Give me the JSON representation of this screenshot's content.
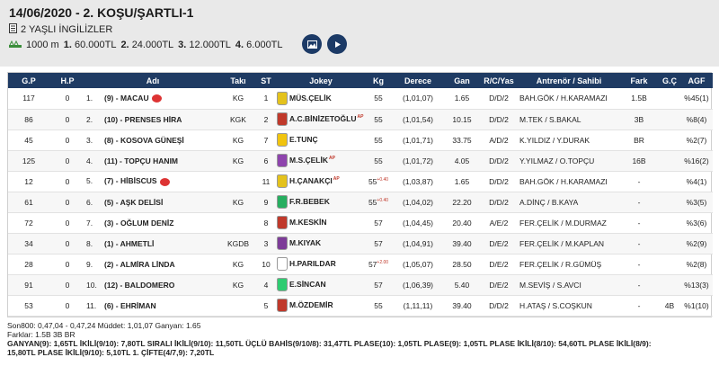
{
  "header": {
    "title": "14/06/2020 - 2. KOŞU/ŞARTLI-1",
    "subtitle": "2 YAŞLI İNGİLİZLER",
    "distance": "1000 m",
    "prizes": [
      {
        "rank": "1.",
        "amount": "60.000TL"
      },
      {
        "rank": "2.",
        "amount": "24.000TL"
      },
      {
        "rank": "3.",
        "amount": "12.000TL"
      },
      {
        "rank": "4.",
        "amount": "6.000TL"
      }
    ],
    "icons": {
      "camera": "camera-icon",
      "video": "play-icon"
    }
  },
  "columns": [
    "G.P",
    "H.P",
    "Adı",
    "Takı",
    "ST",
    "Jokey",
    "Kg",
    "Derece",
    "Gan",
    "R/C/Yas",
    "Antrenör / Sahibi",
    "Fark",
    "G.Ç",
    "AGF"
  ],
  "rows": [
    {
      "gp": "117",
      "hp": "0",
      "rank": "1.",
      "name": "(9) - MACAU",
      "taki": "KG",
      "st": "1",
      "jokey": "MÜS.ÇELİK",
      "jsup": "",
      "kg": "55",
      "kgsup": "",
      "derece": "(1,01,07)",
      "gan": "1.65",
      "rcy": "D/D/2",
      "trainer": "BAH.GÖK / H.KARAMAZI",
      "fark": "1.5B",
      "gc": "",
      "agf": "%45(1)",
      "badge": true,
      "jersey": "#e4c21c"
    },
    {
      "gp": "86",
      "hp": "0",
      "rank": "2.",
      "name": "(10) - PRENSES HİRA",
      "taki": "KGK",
      "st": "2",
      "jokey": "A.C.BİNİZETOĞLU",
      "jsup": "AP",
      "kg": "55",
      "kgsup": "",
      "derece": "(1,01,54)",
      "gan": "10.15",
      "rcy": "D/D/2",
      "trainer": "M.TEK / S.BAKAL",
      "fark": "3B",
      "gc": "",
      "agf": "%8(4)",
      "badge": false,
      "jersey": "#c0392b"
    },
    {
      "gp": "45",
      "hp": "0",
      "rank": "3.",
      "name": "(8) - KOSOVA GÜNEŞİ",
      "taki": "KG",
      "st": "7",
      "jokey": "E.TUNÇ",
      "jsup": "",
      "kg": "55",
      "kgsup": "",
      "derece": "(1,01,71)",
      "gan": "33.75",
      "rcy": "A/D/2",
      "trainer": "K.YILDIZ / Y.DURAK",
      "fark": "BR",
      "gc": "",
      "agf": "%2(7)",
      "badge": false,
      "jersey": "#f1c40f"
    },
    {
      "gp": "125",
      "hp": "0",
      "rank": "4.",
      "name": "(11) - TOPÇU HANIM",
      "taki": "KG",
      "st": "6",
      "jokey": "M.S.ÇELİK",
      "jsup": "AP",
      "kg": "55",
      "kgsup": "",
      "derece": "(1,01,72)",
      "gan": "4.05",
      "rcy": "D/D/2",
      "trainer": "Y.YILMAZ / O.TOPÇU",
      "fark": "16B",
      "gc": "",
      "agf": "%16(2)",
      "badge": false,
      "jersey": "#8e44ad"
    },
    {
      "gp": "12",
      "hp": "0",
      "rank": "5.",
      "name": "(7) - HİBİSCUS",
      "taki": "",
      "st": "11",
      "jokey": "H.ÇANAKÇI",
      "jsup": "AP",
      "kg": "55",
      "kgsup": "+0.40",
      "derece": "(1,03,87)",
      "gan": "1.65",
      "rcy": "D/D/2",
      "trainer": "BAH.GÖK / H.KARAMAZI",
      "fark": "-",
      "gc": "",
      "agf": "%4(1)",
      "badge": true,
      "jersey": "#e4c21c"
    },
    {
      "gp": "61",
      "hp": "0",
      "rank": "6.",
      "name": "(5) - AŞK DELİSİ",
      "taki": "KG",
      "st": "9",
      "jokey": "F.R.BEBEK",
      "jsup": "",
      "kg": "55",
      "kgsup": "+0.40",
      "derece": "(1,04,02)",
      "gan": "22.20",
      "rcy": "D/D/2",
      "trainer": "A.DİNÇ / B.KAYA",
      "fark": "-",
      "gc": "",
      "agf": "%3(5)",
      "badge": false,
      "jersey": "#27ae60"
    },
    {
      "gp": "72",
      "hp": "0",
      "rank": "7.",
      "name": "(3) - OĞLUM DENİZ",
      "taki": "",
      "st": "8",
      "jokey": "M.KESKİN",
      "jsup": "",
      "kg": "57",
      "kgsup": "",
      "derece": "(1,04,45)",
      "gan": "20.40",
      "rcy": "A/E/2",
      "trainer": "FER.ÇELİK / M.DURMAZ",
      "fark": "-",
      "gc": "",
      "agf": "%3(6)",
      "badge": false,
      "jersey": "#c0392b"
    },
    {
      "gp": "34",
      "hp": "0",
      "rank": "8.",
      "name": "(1) - AHMETLİ",
      "taki": "KGDB",
      "st": "3",
      "jokey": "M.KIYAK",
      "jsup": "",
      "kg": "57",
      "kgsup": "",
      "derece": "(1,04,91)",
      "gan": "39.40",
      "rcy": "D/E/2",
      "trainer": "FER.ÇELİK / M.KAPLAN",
      "fark": "-",
      "gc": "",
      "agf": "%2(9)",
      "badge": false,
      "jersey": "#7d3c98"
    },
    {
      "gp": "28",
      "hp": "0",
      "rank": "9.",
      "name": "(2) - ALMİRA LİNDA",
      "taki": "KG",
      "st": "10",
      "jokey": "H.PARILDAR",
      "jsup": "",
      "kg": "57",
      "kgsup": "+2.00",
      "derece": "(1,05,07)",
      "gan": "28.50",
      "rcy": "D/E/2",
      "trainer": "FER.ÇELİK / R.GÜMÜŞ",
      "fark": "-",
      "gc": "",
      "agf": "%2(8)",
      "badge": false,
      "jersey": "#ffffff"
    },
    {
      "gp": "91",
      "hp": "0",
      "rank": "10.",
      "name": "(12) - BALDOMERO",
      "taki": "KG",
      "st": "4",
      "jokey": "E.SİNCAN",
      "jsup": "",
      "kg": "57",
      "kgsup": "",
      "derece": "(1,06,39)",
      "gan": "5.40",
      "rcy": "D/E/2",
      "trainer": "M.SEVİŞ / S.AVCI",
      "fark": "-",
      "gc": "",
      "agf": "%13(3)",
      "badge": false,
      "jersey": "#2ecc71"
    },
    {
      "gp": "53",
      "hp": "0",
      "rank": "11.",
      "name": "(6) - EHRİMAN",
      "taki": "",
      "st": "5",
      "jokey": "M.ÖZDEMİR",
      "jsup": "",
      "kg": "55",
      "kgsup": "",
      "derece": "(1,11,11)",
      "gan": "39.40",
      "rcy": "D/D/2",
      "trainer": "H.ATAŞ / S.COŞKUN",
      "fark": "-",
      "gc": "4B",
      "agf": "%1(10)",
      "badge": false,
      "jersey": "#c0392b"
    }
  ],
  "footer": {
    "line1": "Son800: 0,47,04 - 0,47,24 Müddet: 1,01,07 Ganyan: 1.65",
    "line2": "Farklar: 1.5B 3B BR",
    "line3": "GANYAN(9): 1,65TL İKİLİ(9/10): 7,80TL SIRALI İKİLİ(9/10): 11,50TL ÜÇLÜ BAHİS(9/10/8): 31,47TL PLASE(10): 1,05TL PLASE(9): 1,05TL PLASE İKİLİ(8/10): 54,60TL PLASE İKİLİ(8/9):",
    "line4": "15,80TL PLASE İKİLİ(9/10): 5,10TL 1. ÇİFTE(4/7,9): 7,20TL"
  }
}
